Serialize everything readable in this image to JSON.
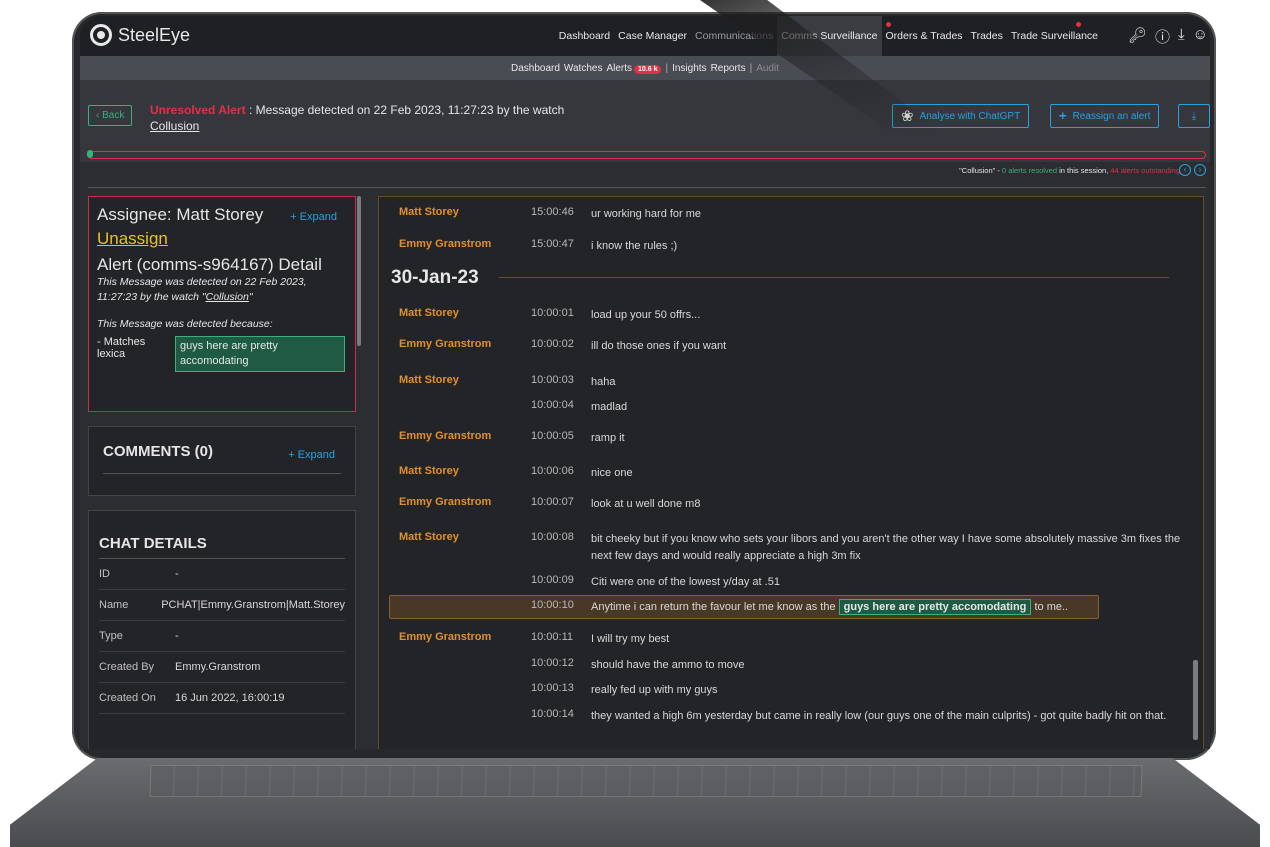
{
  "app": {
    "name": "SteelEye"
  },
  "topnav": {
    "items": [
      "Dashboard",
      "Case Manager",
      "Communications",
      "Comms Surveillance",
      "Orders & Trades",
      "Trades",
      "Trade Surveillance"
    ],
    "active": "Comms Surveillance"
  },
  "subnav": {
    "items": [
      "Dashboard",
      "Watches",
      "Alerts",
      "Insights",
      "Reports",
      "Audit"
    ],
    "alerts_badge": "10.6 k"
  },
  "alert": {
    "back_label": "‹ Back",
    "status": "Unresolved Alert",
    "message": ": Message detected on 22 Feb 2023, 11:27:23 by the watch",
    "watch_name": "Collusion",
    "analyse_label": "Analyse with ChatGPT",
    "reassign_label": "Reassign an alert",
    "progress_fraction": 0.0
  },
  "session": {
    "prefix": "\"Collusion\" - ",
    "resolved": "0 alerts resolved",
    "middle": " in this session, ",
    "outstanding": "44 alerts outstanding"
  },
  "assignee": {
    "label": "Assignee: Matt Storey",
    "expand": "+ Expand",
    "unassign": "Unassign",
    "detail_title": "Alert (comms-s964167) Detail",
    "detected_prefix": "This Message was detected on 22 Feb 2023, 11:27:23 by the watch \"",
    "detected_watch": "Collusion",
    "detected_suffix": "\"",
    "because": "This Message was detected because:",
    "matches_label": "- Matches lexica",
    "lexica_term": "guys here are pretty accomodating"
  },
  "comments": {
    "title": "COMMENTS (0)",
    "expand": "+ Expand"
  },
  "chat_details": {
    "title": "CHAT DETAILS",
    "rows": [
      {
        "k": "ID",
        "v": "-"
      },
      {
        "k": "Name",
        "v": "PCHAT|Emmy.Granstrom|Matt.Storey"
      },
      {
        "k": "Type",
        "v": "-"
      },
      {
        "k": "Created By",
        "v": "Emmy.Granstrom"
      },
      {
        "k": "Created On",
        "v": "16 Jun 2022, 16:00:19"
      }
    ]
  },
  "chat": {
    "date_header": "30-Jan-23",
    "pre": [
      {
        "who": "Matt Storey",
        "time": "15:00:46",
        "text": "ur working hard for me"
      },
      {
        "who": "Emmy Granstrom",
        "time": "15:00:47",
        "text": "i know the rules ;)"
      }
    ],
    "messages": [
      {
        "who": "Matt Storey",
        "time": "10:00:01",
        "text": "load up your 50 offrs..."
      },
      {
        "who": "Emmy Granstrom",
        "time": "10:00:02",
        "text": "ill do those ones if you want"
      },
      {
        "who": "Matt Storey",
        "time": "10:00:03",
        "text": "haha"
      },
      {
        "who": "",
        "time": "10:00:04",
        "text": "madlad"
      },
      {
        "who": "Emmy Granstrom",
        "time": "10:00:05",
        "text": "ramp it"
      },
      {
        "who": "Matt Storey",
        "time": "10:00:06",
        "text": "nice one"
      },
      {
        "who": "Emmy Granstrom",
        "time": "10:00:07",
        "text": "look at u well done m8"
      },
      {
        "who": "Matt Storey",
        "time": "10:00:08",
        "text": "bit cheeky but if you know who sets your libors and you aren't the other way I have some absolutely massive 3m fixes the next few days and would really appreciate a high 3m fix"
      },
      {
        "who": "",
        "time": "10:00:09",
        "text": "Citi were one of the lowest y/day at .51"
      },
      {
        "who": "",
        "time": "10:00:10",
        "text_before": "Anytime i can return the favour let me know as the",
        "term": "guys here are pretty accomodating",
        "text_after": "to me.."
      },
      {
        "who": "Emmy Granstrom",
        "time": "10:00:11",
        "text": "I will try my best"
      },
      {
        "who": "",
        "time": "10:00:12",
        "text": "should have the ammo to move"
      },
      {
        "who": "",
        "time": "10:00:13",
        "text": "really fed up with my guys"
      },
      {
        "who": "",
        "time": "10:00:14",
        "text": "they wanted a high 6m yesterday but came in really low (our guys one of the main culprits) - got quite badly hit on that."
      }
    ]
  }
}
